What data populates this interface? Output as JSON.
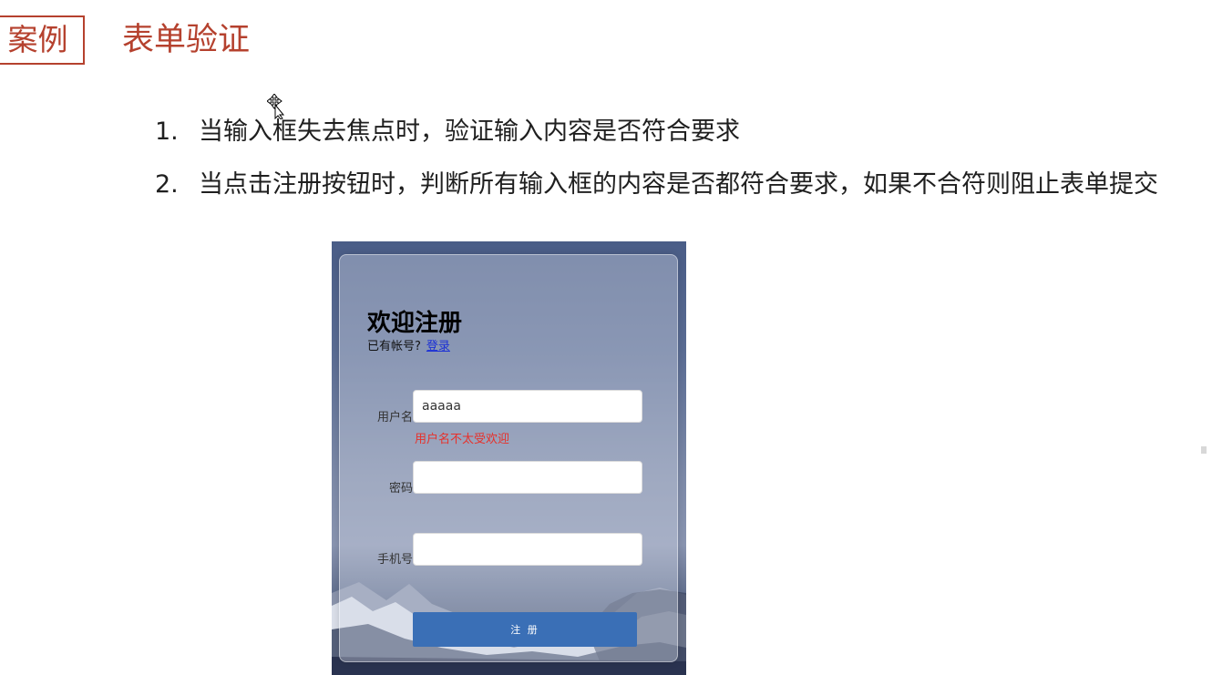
{
  "header": {
    "tag_label": "案例",
    "title": "表单验证"
  },
  "steps": [
    {
      "num": "1.",
      "text": "当输入框失去焦点时，验证输入内容是否符合要求"
    },
    {
      "num": "2.",
      "text": "当点击注册按钮时，判断所有输入框的内容是否都符合要求，如果不合符则阻止表单提交"
    }
  ],
  "form": {
    "title": "欢迎注册",
    "subtitle": "已有帐号?",
    "login_link": "登录",
    "fields": [
      {
        "label": "用户名",
        "value": "aaaaa",
        "placeholder": ""
      },
      {
        "label": "密码",
        "value": "",
        "placeholder": ""
      },
      {
        "label": "手机号",
        "value": "",
        "placeholder": ""
      }
    ],
    "error": "用户名不太受欢迎",
    "submit_label": "注 册"
  },
  "colors": {
    "accent": "#b5412e",
    "error": "#e8302a",
    "button": "#3a6fb6",
    "link": "#1a2fd6"
  },
  "icons": {
    "cursor": "move-cursor-icon"
  }
}
